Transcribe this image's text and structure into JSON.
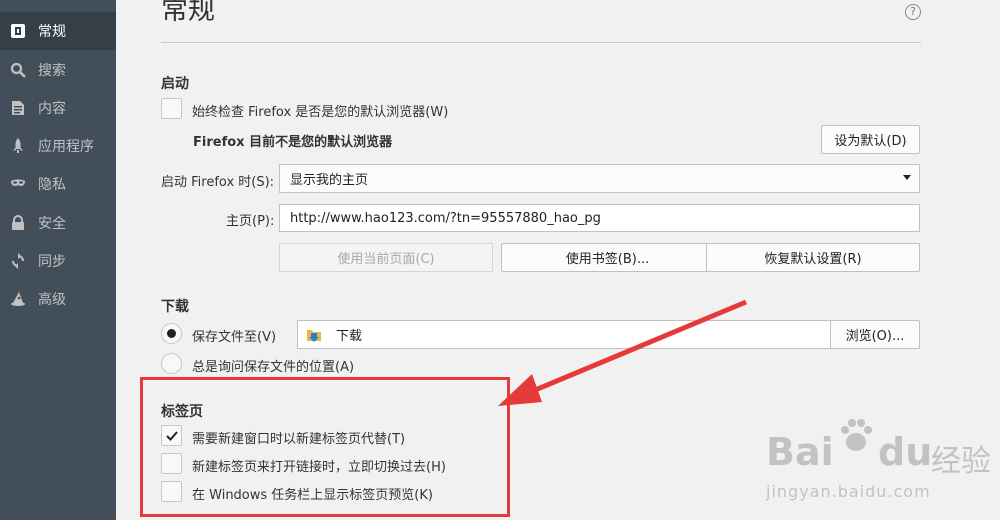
{
  "sidebar": {
    "items": [
      {
        "label": "常规",
        "icon": "general-icon",
        "selected": true
      },
      {
        "label": "搜索",
        "icon": "search-icon",
        "selected": false
      },
      {
        "label": "内容",
        "icon": "content-icon",
        "selected": false
      },
      {
        "label": "应用程序",
        "icon": "rocket-icon",
        "selected": false
      },
      {
        "label": "隐私",
        "icon": "mask-icon",
        "selected": false
      },
      {
        "label": "安全",
        "icon": "lock-icon",
        "selected": false
      },
      {
        "label": "同步",
        "icon": "sync-icon",
        "selected": false
      },
      {
        "label": "高级",
        "icon": "wizard-hat-icon",
        "selected": false
      }
    ]
  },
  "page": {
    "title": "常规",
    "help": "?"
  },
  "startup": {
    "heading": "启动",
    "check_default_label": "始终检查 Firefox 是否是您的默认浏览器(W)",
    "check_default_checked": false,
    "not_default_text": "Firefox 目前不是您的默认浏览器",
    "set_default_button": "设为默认(D)",
    "start_label": "启动 Firefox 时(S):",
    "start_value": "显示我的主页",
    "homepage_label": "主页(P):",
    "homepage_value": "http://www.hao123.com/?tn=95557880_hao_pg",
    "use_current_button": "使用当前页面(C)",
    "use_bookmark_button": "使用书签(B)...",
    "restore_default_button": "恢复默认设置(R)"
  },
  "downloads": {
    "heading": "下载",
    "save_to_label": "保存文件至(V)",
    "save_to_selected": true,
    "folder_value": "下载",
    "browse_button": "浏览(O)...",
    "always_ask_label": "总是询问保存文件的位置(A)",
    "always_ask_selected": false
  },
  "tabs": {
    "heading": "标签页",
    "options": [
      {
        "label": "需要新建窗口时以新建标签页代替(T)",
        "checked": true
      },
      {
        "label": "新建标签页来打开链接时，立即切换过去(H)",
        "checked": false
      },
      {
        "label": "在 Windows 任务栏上显示标签页预览(K)",
        "checked": false
      }
    ]
  },
  "annotation": {
    "color": "#e63a3a"
  },
  "watermark": {
    "brand": "Bai",
    "brand2": "du",
    "cn": "经验",
    "url": "jingyan.baidu.com"
  },
  "colors": {
    "sidebar_bg": "#424f5a",
    "sidebar_selected": "#343f48",
    "main_bg": "#f1f1f1"
  }
}
